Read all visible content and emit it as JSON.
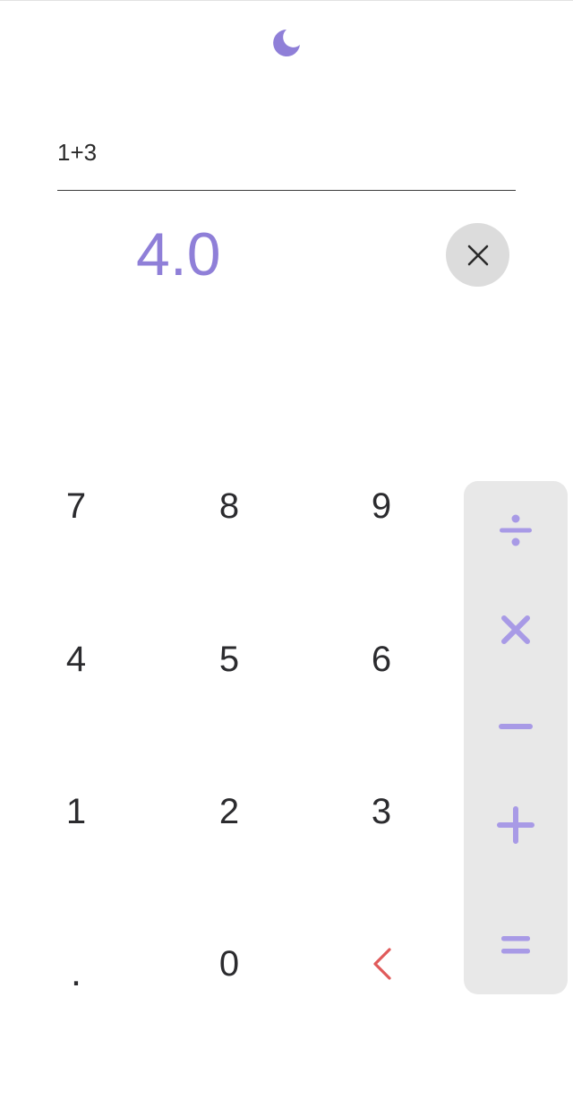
{
  "display": {
    "expression": "1+3",
    "result": "4.0"
  },
  "theme_toggle": {
    "icon": "moon-icon",
    "color": "#8f7fd8"
  },
  "clear_button": {
    "icon": "close-icon"
  },
  "keypad": {
    "row1": [
      "7",
      "8",
      "9"
    ],
    "row2": [
      "4",
      "5",
      "6"
    ],
    "row3": [
      "1",
      "2",
      "3"
    ],
    "row4": [
      ".",
      "0"
    ],
    "backspace_icon": "chevron-left-icon",
    "backspace_color": "#e05a5a"
  },
  "operators": {
    "icons": [
      "divide-icon",
      "multiply-icon",
      "minus-icon",
      "plus-icon",
      "equals-icon"
    ],
    "color": "#a89ae6",
    "panel_color": "#e8e8e8"
  },
  "colors": {
    "accent": "#8f7fd8",
    "digit": "#2b2b2e",
    "background": "#ffffff"
  }
}
